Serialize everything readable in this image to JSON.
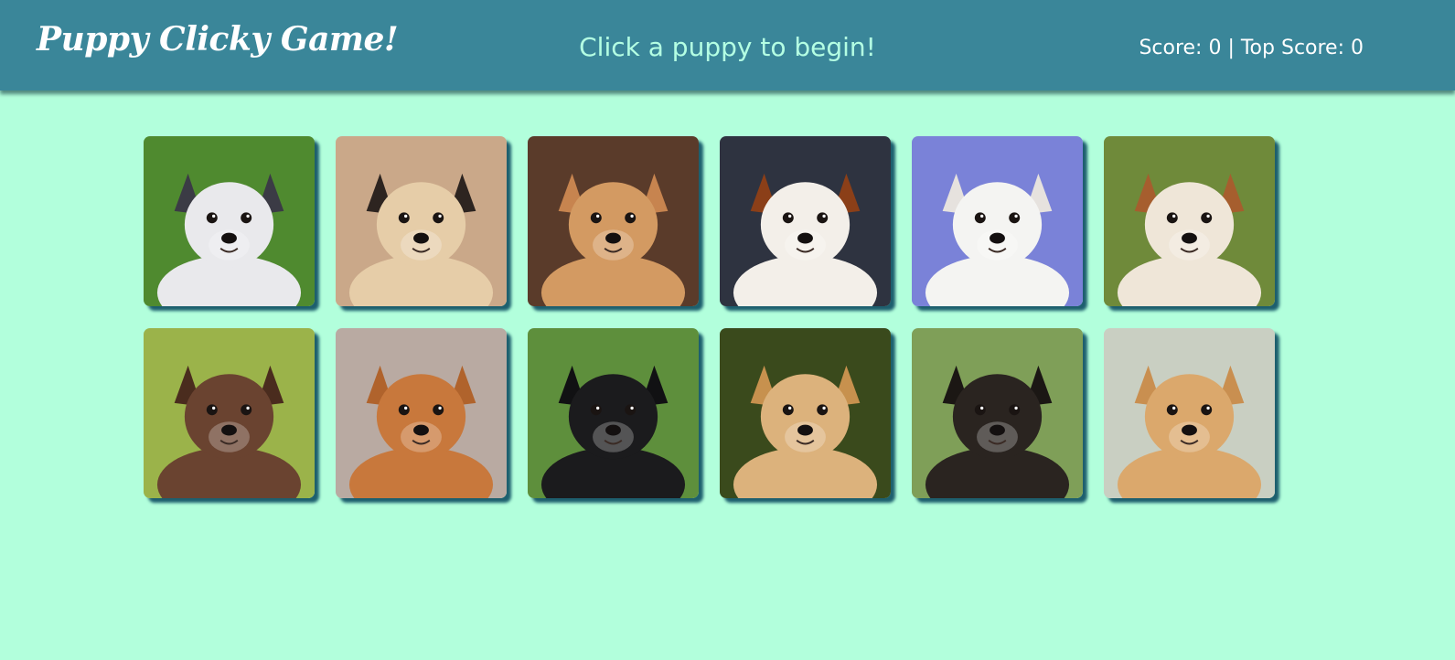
{
  "header": {
    "brand": "Puppy Clicky Game!",
    "status": "Click a puppy to begin!",
    "score_text": "Score: 0 | Top Score: 0"
  },
  "cards": [
    {
      "name": "husky-puppy",
      "bg": "#4f8a2f",
      "fur": "#e9e9ec",
      "ear": "#3b3b45"
    },
    {
      "name": "pug-puppy",
      "bg": "#caa889",
      "fur": "#e6cda8",
      "ear": "#2d2420"
    },
    {
      "name": "shiba-puppy",
      "bg": "#5a3b2a",
      "fur": "#d39a62",
      "ear": "#c7844f"
    },
    {
      "name": "cavalier-puppy",
      "bg": "#2e3340",
      "fur": "#f3efe9",
      "ear": "#8b3f18"
    },
    {
      "name": "white-fluffy-puppy",
      "bg": "#7a82d8",
      "fur": "#f4f4f2",
      "ear": "#e6e2de"
    },
    {
      "name": "bulldog-puppy",
      "bg": "#6f8a3a",
      "fur": "#efe6d8",
      "ear": "#a65e2e"
    },
    {
      "name": "brown-lab-puppy",
      "bg": "#9bb34a",
      "fur": "#6a4330",
      "ear": "#4a2c1e"
    },
    {
      "name": "corgi-puppy",
      "bg": "#b9aaa2",
      "fur": "#c8783c",
      "ear": "#b0632c"
    },
    {
      "name": "black-lab-puppy",
      "bg": "#5e8f3c",
      "fur": "#1b1b1d",
      "ear": "#111113"
    },
    {
      "name": "golden-retriever-puppy",
      "bg": "#3a4a1c",
      "fur": "#dcb27c",
      "ear": "#c7914e"
    },
    {
      "name": "german-shepherd-puppy",
      "bg": "#7f9f58",
      "fur": "#2a2420",
      "ear": "#1b1714"
    },
    {
      "name": "pomeranian-puppy",
      "bg": "#c9cfc2",
      "fur": "#dba86c",
      "ear": "#c98f50"
    }
  ]
}
